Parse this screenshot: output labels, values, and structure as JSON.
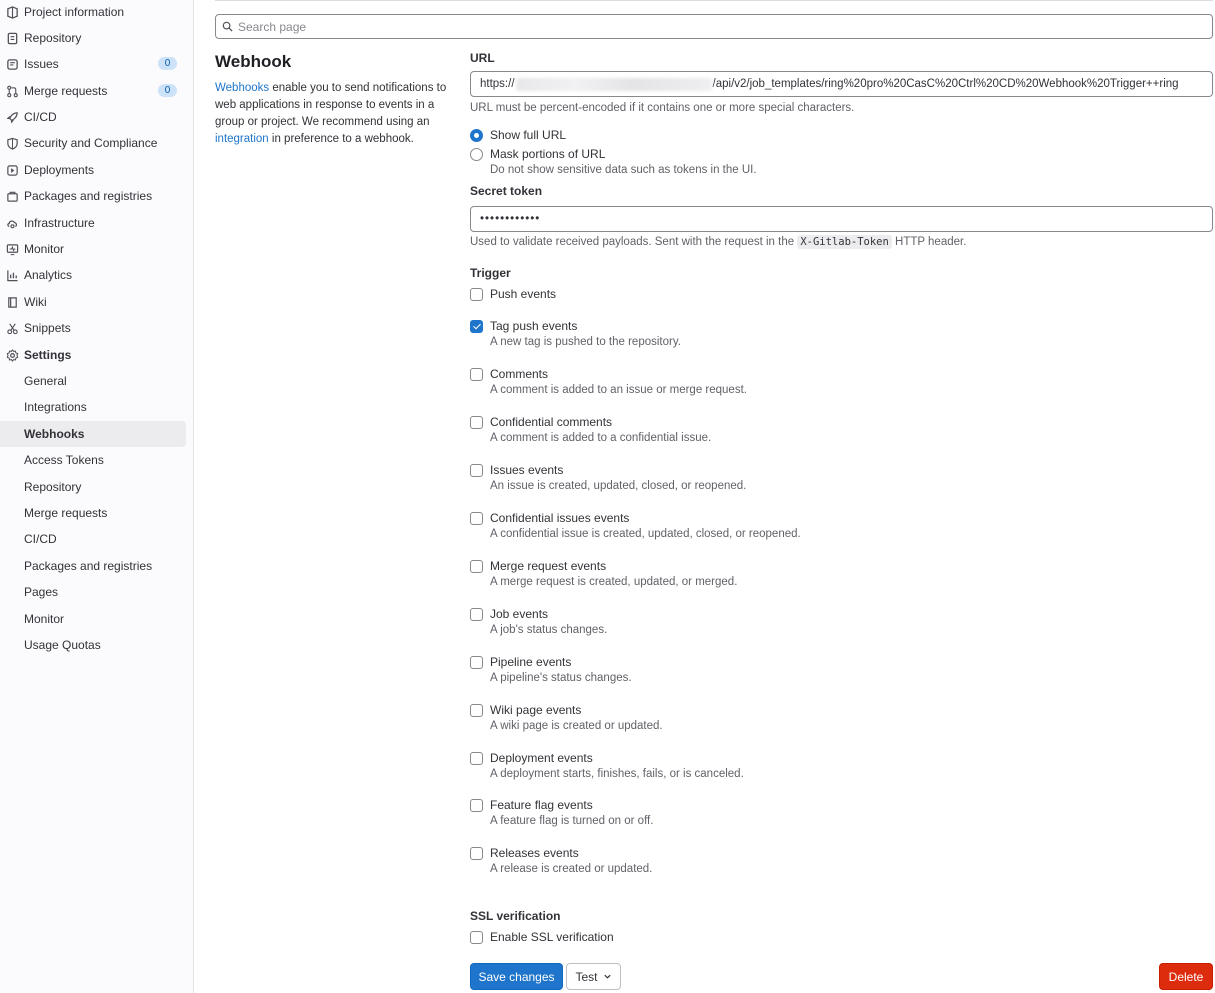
{
  "sidebar": {
    "items": [
      {
        "label": "Project information",
        "icon": "project-icon"
      },
      {
        "label": "Repository",
        "icon": "doc-icon"
      },
      {
        "label": "Issues",
        "icon": "issues-icon",
        "badge": "0"
      },
      {
        "label": "Merge requests",
        "icon": "merge-request-icon",
        "badge": "0"
      },
      {
        "label": "CI/CD",
        "icon": "rocket-icon"
      },
      {
        "label": "Security and Compliance",
        "icon": "shield-icon"
      },
      {
        "label": "Deployments",
        "icon": "deployments-icon"
      },
      {
        "label": "Packages and registries",
        "icon": "package-icon"
      },
      {
        "label": "Infrastructure",
        "icon": "cloud-gear-icon"
      },
      {
        "label": "Monitor",
        "icon": "monitor-icon"
      },
      {
        "label": "Analytics",
        "icon": "chart-icon"
      },
      {
        "label": "Wiki",
        "icon": "book-icon"
      },
      {
        "label": "Snippets",
        "icon": "scissors-icon"
      },
      {
        "label": "Settings",
        "icon": "settings-icon"
      }
    ],
    "settings_subitems": [
      {
        "label": "General"
      },
      {
        "label": "Integrations"
      },
      {
        "label": "Webhooks",
        "active": true
      },
      {
        "label": "Access Tokens"
      },
      {
        "label": "Repository"
      },
      {
        "label": "Merge requests"
      },
      {
        "label": "CI/CD"
      },
      {
        "label": "Packages and registries"
      },
      {
        "label": "Pages"
      },
      {
        "label": "Monitor"
      },
      {
        "label": "Usage Quotas"
      }
    ]
  },
  "search": {
    "placeholder": "Search page"
  },
  "section": {
    "title": "Webhook",
    "desc_link1": "Webhooks",
    "desc_part1": " enable you to send notifications to web applications in response to events in a group or project. We recommend using an ",
    "desc_link2": "integration",
    "desc_part2": " in preference to a webhook."
  },
  "url": {
    "label": "URL",
    "value_prefix": "https://",
    "value_suffix": "/api/v2/job_templates/ring%20pro%20CasC%20Ctrl%20CD%20Webhook%20Trigger++ring",
    "help": "URL must be percent-encoded if it contains one or more special characters.",
    "show_full": "Show full URL",
    "mask": "Mask portions of URL",
    "mask_desc": "Do not show sensitive data such as tokens in the UI."
  },
  "secret": {
    "label": "Secret token",
    "value": "••••••••••••",
    "help_prefix": "Used to validate received payloads. Sent with the request in the ",
    "header_code": "X-Gitlab-Token",
    "help_suffix": " HTTP header."
  },
  "trigger": {
    "label": "Trigger",
    "items": [
      {
        "label": "Push events",
        "desc": "",
        "checked": false
      },
      {
        "label": "Tag push events",
        "desc": "A new tag is pushed to the repository.",
        "checked": true
      },
      {
        "label": "Comments",
        "desc": "A comment is added to an issue or merge request.",
        "checked": false
      },
      {
        "label": "Confidential comments",
        "desc": "A comment is added to a confidential issue.",
        "checked": false
      },
      {
        "label": "Issues events",
        "desc": "An issue is created, updated, closed, or reopened.",
        "checked": false
      },
      {
        "label": "Confidential issues events",
        "desc": "A confidential issue is created, updated, closed, or reopened.",
        "checked": false
      },
      {
        "label": "Merge request events",
        "desc": "A merge request is created, updated, or merged.",
        "checked": false
      },
      {
        "label": "Job events",
        "desc": "A job's status changes.",
        "checked": false
      },
      {
        "label": "Pipeline events",
        "desc": "A pipeline's status changes.",
        "checked": false
      },
      {
        "label": "Wiki page events",
        "desc": "A wiki page is created or updated.",
        "checked": false
      },
      {
        "label": "Deployment events",
        "desc": "A deployment starts, finishes, fails, or is canceled.",
        "checked": false
      },
      {
        "label": "Feature flag events",
        "desc": "A feature flag is turned on or off.",
        "checked": false
      },
      {
        "label": "Releases events",
        "desc": "A release is created or updated.",
        "checked": false
      }
    ]
  },
  "ssl": {
    "label": "SSL verification",
    "checkbox": "Enable SSL verification",
    "checked": false
  },
  "actions": {
    "save": "Save changes",
    "test": "Test",
    "delete": "Delete"
  },
  "colors": {
    "primary": "#1f75cb",
    "danger": "#dd2b0e",
    "badge_bg": "#cbe2f9"
  }
}
